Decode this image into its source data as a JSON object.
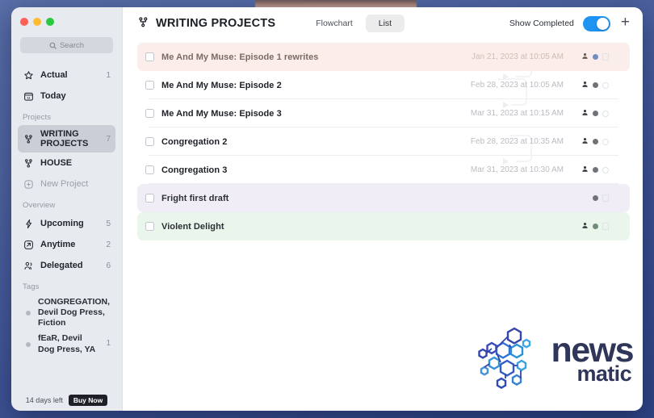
{
  "window": {
    "traffic_lights": [
      "close",
      "minimize",
      "maximize"
    ]
  },
  "sidebar": {
    "search": {
      "placeholder": "Search",
      "icon": "search-icon"
    },
    "nav": [
      {
        "label": "Actual",
        "count": "1",
        "icon": "star-icon",
        "selected": false,
        "muted": false
      },
      {
        "label": "Today",
        "count": "",
        "icon": "calendar-icon",
        "selected": false,
        "muted": false
      }
    ],
    "projects_header": "Projects",
    "projects": [
      {
        "label": "WRITING PROJECTS",
        "count": "7",
        "icon": "project-node-icon",
        "selected": true,
        "muted": false
      },
      {
        "label": "HOUSE",
        "count": "",
        "icon": "project-node-icon",
        "selected": false,
        "muted": false
      },
      {
        "label": "New Project",
        "count": "",
        "icon": "plus-square-icon",
        "selected": false,
        "muted": true
      }
    ],
    "overview_header": "Overview",
    "overview": [
      {
        "label": "Upcoming",
        "count": "5",
        "icon": "bolt-icon",
        "selected": false,
        "muted": false
      },
      {
        "label": "Anytime",
        "count": "2",
        "icon": "anytime-icon",
        "selected": false,
        "muted": false
      },
      {
        "label": "Delegated",
        "count": "6",
        "icon": "people-icon",
        "selected": false,
        "muted": false
      }
    ],
    "tags_header": "Tags",
    "tags": [
      {
        "label": "CONGREGATION, Devil Dog Press, Fiction",
        "count": "",
        "dot_color": "#b5bac2"
      },
      {
        "label": "fEaR, Devil Dog Press, YA",
        "count": "1",
        "dot_color": "#b5bac2"
      }
    ],
    "footer": {
      "trial_text": "14 days left",
      "buy_label": "Buy Now"
    }
  },
  "toolbar": {
    "project_icon": "project-node-icon",
    "project_title": "WRITING PROJECTS",
    "views": [
      {
        "label": "Flowchart",
        "active": false
      },
      {
        "label": "List",
        "active": true
      }
    ],
    "show_completed_label": "Show Completed",
    "show_completed_on": true,
    "switch_color": "#1f93f2",
    "add_label": "+"
  },
  "tasks": [
    {
      "name": "Me And My Muse: Episode 1 rewrites",
      "date": "Jan 21, 2023 at 10:05 AM",
      "checked": false,
      "tint": "#fbeeea",
      "name_color": "#7d6a64",
      "date_color": "#cfbcb6",
      "has_person": true,
      "dot_color": "#6f8fc0",
      "trailing": "flag"
    },
    {
      "name": "Me And My Muse: Episode 2",
      "date": "Feb 28, 2023 at 10:05 AM",
      "checked": false,
      "tint": "",
      "name_color": "#1d2127",
      "date_color": "#b9bcc2",
      "has_person": true,
      "dot_color": "#6f7378",
      "trailing": "ring"
    },
    {
      "name": "Me And My Muse: Episode 3",
      "date": "Mar 31, 2023 at 10:15 AM",
      "checked": false,
      "tint": "",
      "name_color": "#1d2127",
      "date_color": "#b9bcc2",
      "has_person": true,
      "dot_color": "#6f7378",
      "trailing": "ring"
    },
    {
      "name": "Congregation 2",
      "date": "Feb 28, 2023 at 10:35 AM",
      "checked": false,
      "tint": "",
      "name_color": "#1d2127",
      "date_color": "#b9bcc2",
      "has_person": true,
      "dot_color": "#6f7378",
      "trailing": "ring"
    },
    {
      "name": "Congregation 3",
      "date": "Mar 31, 2023 at 10:30 AM",
      "checked": false,
      "tint": "",
      "name_color": "#1d2127",
      "date_color": "#b9bcc2",
      "has_person": true,
      "dot_color": "#6f7378",
      "trailing": "ring"
    },
    {
      "name": "Fright first draft",
      "date": "",
      "checked": false,
      "tint": "#f1edf6",
      "name_color": "#2b2f36",
      "date_color": "#b9bcc2",
      "has_person": false,
      "dot_color": "#6f7378",
      "trailing": "flag"
    },
    {
      "name": "Violent Delight",
      "date": "",
      "checked": false,
      "tint": "#eaf5ec",
      "name_color": "#2b2f36",
      "date_color": "#b9bcc2",
      "has_person": true,
      "dot_color": "#6f8c78",
      "trailing": "flag"
    }
  ],
  "watermark": {
    "line1": "news",
    "line2": "matic"
  }
}
